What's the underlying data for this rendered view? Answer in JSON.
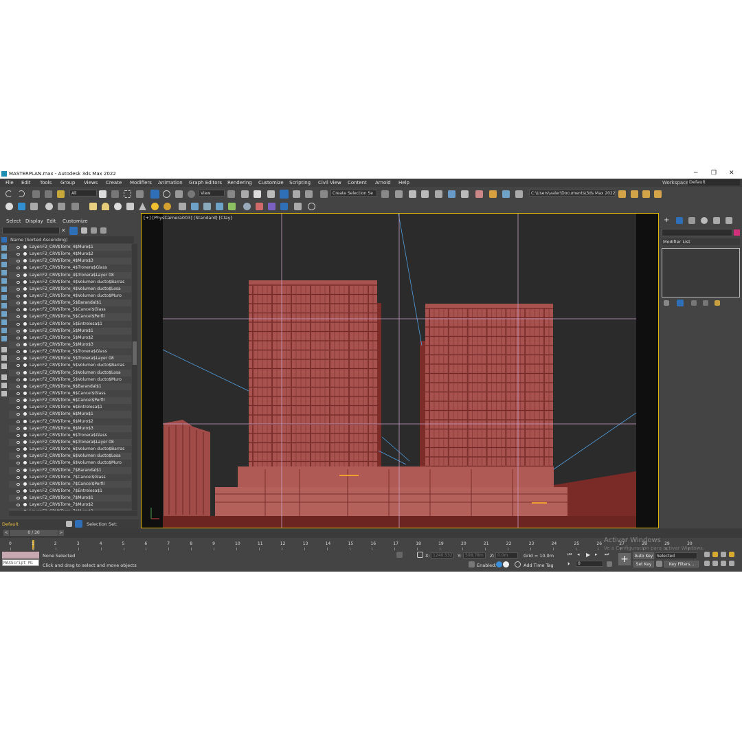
{
  "window": {
    "title": "MASTERPLAN.max - Autodesk 3ds Max 2022",
    "controls": [
      "─",
      "❐",
      "✕"
    ]
  },
  "menu": {
    "items": [
      "File",
      "Edit",
      "Tools",
      "Group",
      "Views",
      "Create",
      "Modifiers",
      "Animation",
      "Graph Editors",
      "Rendering",
      "Customize",
      "Scripting",
      "Civil View",
      "Content",
      "Arnold",
      "Help"
    ],
    "workspaces_label": "Workspaces:",
    "workspace_value": "Default"
  },
  "toolbar": {
    "selection_filter": "All",
    "reference_coord": "View",
    "named_selection": "Create Selection Se",
    "project_path": "C:\\Users\\valer\\Documents\\3ds Max 2022"
  },
  "explorer": {
    "tabs": [
      "Select",
      "Display",
      "Edit",
      "Customize"
    ],
    "column_header": "Name (Sorted Ascending)",
    "items": [
      "Layer:F2_CRV$Torre_4$Muro$1",
      "Layer:F2_CRV$Torre_4$Muro$2",
      "Layer:F2_CRV$Torre_4$Muro$3",
      "Layer:F2_CRV$Torre_4$Tronera$Glass",
      "Layer:F2_CRV$Torre_4$Tronera$Layer 08",
      "Layer:F2_CRV$Torre_4$Volumen ducto$Barras",
      "Layer:F2_CRV$Torre_4$Volumen ducto$Losa",
      "Layer:F2_CRV$Torre_4$Volumen ducto$Muro",
      "Layer:F2_CRV$Torre_5$Barandal$1",
      "Layer:F2_CRV$Torre_5$Cancel$Glass",
      "Layer:F2_CRV$Torre_5$Cancel$Perfil",
      "Layer:F2_CRV$Torre_5$Entrelosa$1",
      "Layer:F2_CRV$Torre_5$Muro$1",
      "Layer:F2_CRV$Torre_5$Muro$2",
      "Layer:F2_CRV$Torre_5$Muro$3",
      "Layer:F2_CRV$Torre_5$Tronera$Glass",
      "Layer:F2_CRV$Torre_5$Tronera$Layer 08",
      "Layer:F2_CRV$Torre_5$Volumen ducto$Barras",
      "Layer:F2_CRV$Torre_5$Volumen ducto$Losa",
      "Layer:F2_CRV$Torre_5$Volumen ducto$Muro",
      "Layer:F2_CRV$Torre_6$Barandal$1",
      "Layer:F2_CRV$Torre_6$Cancel$Glass",
      "Layer:F2_CRV$Torre_6$Cancel$Perfil",
      "Layer:F2_CRV$Torre_6$Entrelosa$1",
      "Layer:F2_CRV$Torre_6$Muro$1",
      "Layer:F2_CRV$Torre_6$Muro$2",
      "Layer:F2_CRV$Torre_6$Muro$3",
      "Layer:F2_CRV$Torre_6$Tronera$Glass",
      "Layer:F2_CRV$Torre_6$Tronera$Layer 08",
      "Layer:F2_CRV$Torre_6$Volumen ducto$Barras",
      "Layer:F2_CRV$Torre_6$Volumen ducto$Losa",
      "Layer:F2_CRV$Torre_6$Volumen ducto$Muro",
      "Layer:F2_CRV$Torre_7$Barandal$1",
      "Layer:F2_CRV$Torre_7$Cancel$Glass",
      "Layer:F2_CRV$Torre_7$Cancel$Perfil",
      "Layer:F2_CRV$Torre_7$Entrelosa$1",
      "Layer:F2_CRV$Torre_7$Muro$1",
      "Layer:F2_CRV$Torre_7$Muro$2",
      "Layer:F2_CRV$Torre_7$Muro$3"
    ],
    "layer_value": "Default",
    "selection_set_label": "Selection Set:"
  },
  "viewport": {
    "label": "[+] [PhysCamera003] [Standard] [Clay]"
  },
  "command_panel": {
    "modifier_list": "Modifier List"
  },
  "timeline": {
    "frame_display": "0 / 30",
    "ticks": [
      "0",
      "1",
      "2",
      "3",
      "4",
      "5",
      "6",
      "7",
      "8",
      "9",
      "10",
      "11",
      "12",
      "13",
      "14",
      "15",
      "16",
      "17",
      "18",
      "19",
      "20",
      "21",
      "22",
      "23",
      "24",
      "25",
      "26",
      "27",
      "28",
      "29",
      "30"
    ]
  },
  "status": {
    "maxscript_placeholder": "MAXScript Mi",
    "selection_status": "None Selected",
    "prompt": "Click and drag to select and move objects",
    "x_label": "X:",
    "x_value": "1240.532m",
    "y_label": "Y:",
    "y_value": "508.78m",
    "z_label": "Z:",
    "z_value": "0.0m",
    "grid": "Grid = 10.0m",
    "enabled_label": "Enabled:",
    "add_time_tag": "Add Time Tag",
    "auto_key": "Auto Key",
    "selected_value": "Selected",
    "set_key": "Set Key",
    "key_filters": "Key Filters...",
    "frame_value": "0"
  },
  "watermark": {
    "line1": "Activar Windows",
    "line2": "Ve a Configuración para activar Windows."
  },
  "colors": {
    "ui_bg": "#444444",
    "viewport_bg": "#2b2b2b",
    "building": "#a8524f",
    "selection_border": "#e0b700",
    "accent": "#2f6fb8"
  }
}
